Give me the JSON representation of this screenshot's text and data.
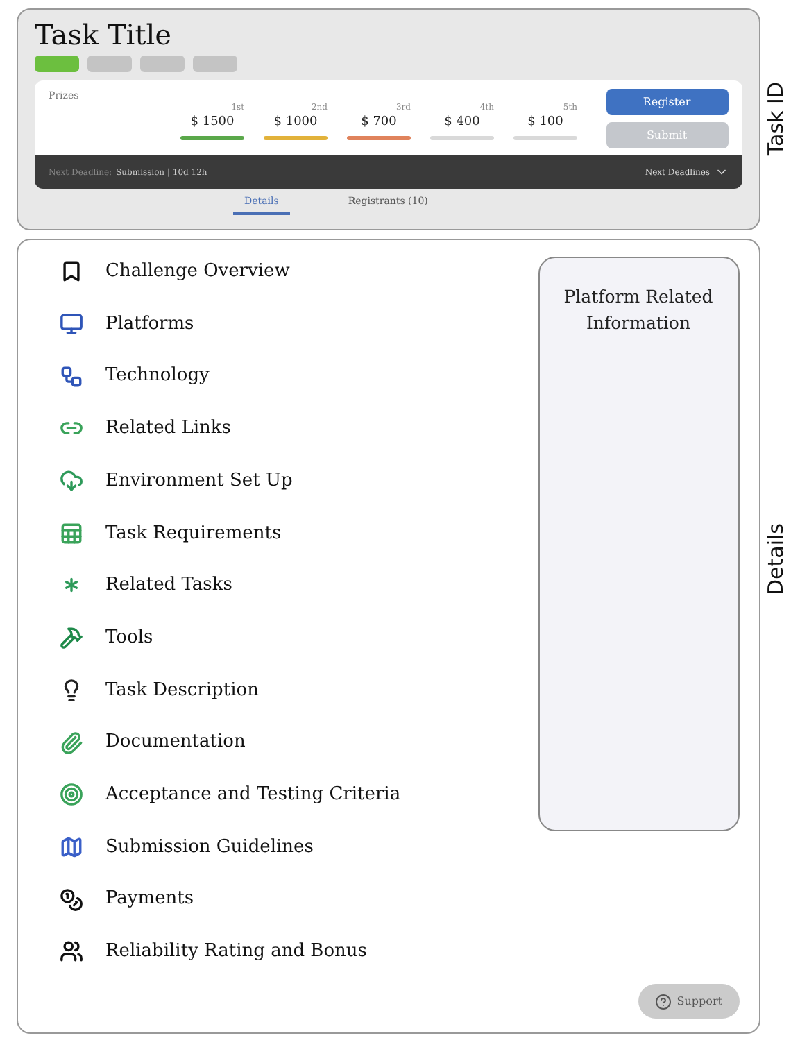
{
  "header": {
    "title": "Task Title",
    "chips": [
      {
        "color": "#6cbf3f"
      },
      {
        "color": "#c4c4c4"
      },
      {
        "color": "#c4c4c4"
      },
      {
        "color": "#c4c4c4"
      }
    ],
    "prizes": {
      "label": "Prizes",
      "items": [
        {
          "place": "1st",
          "amount": "$ 1500",
          "color": "#5aa84a"
        },
        {
          "place": "2nd",
          "amount": "$ 1000",
          "color": "#e2b23a"
        },
        {
          "place": "3rd",
          "amount": "$ 700",
          "color": "#e0835c"
        },
        {
          "place": "4th",
          "amount": "$ 400",
          "color": "#d9d9d9"
        },
        {
          "place": "5th",
          "amount": "$ 100",
          "color": "#d9d9d9"
        }
      ]
    },
    "buttons": [
      {
        "label": "Register",
        "disabled": false
      },
      {
        "label": "Submit",
        "disabled": true
      }
    ],
    "deadline": {
      "label": "Next Deadline:",
      "value": "Submission | 10d 12h",
      "toggle": "Next Deadlines"
    },
    "tabs": [
      {
        "label": "Details",
        "selected": true
      },
      {
        "label": "Registrants (10)",
        "selected": false
      }
    ],
    "side_label": "Task ID"
  },
  "details": {
    "items": [
      {
        "label": "Challenge Overview",
        "color": "#111111"
      },
      {
        "label": "Platforms",
        "color": "#2f55b8"
      },
      {
        "label": "Technology",
        "color": "#2f55b8"
      },
      {
        "label": "Related Links",
        "color": "#3aa35a"
      },
      {
        "label": "Environment Set Up",
        "color": "#2e9a5a"
      },
      {
        "label": "Task Requirements",
        "color": "#3aa35a"
      },
      {
        "label": "Related Tasks",
        "color": "#2e9a5a"
      },
      {
        "label": "Tools",
        "color": "#1f8a4a"
      },
      {
        "label": "Task Description",
        "color": "#222222"
      },
      {
        "label": "Documentation",
        "color": "#3aa35a"
      },
      {
        "label": "Acceptance and Testing Criteria",
        "color": "#3aa35a"
      },
      {
        "label": "Submission Guidelines",
        "color": "#3a5fc8"
      },
      {
        "label": "Payments",
        "color": "#111111"
      },
      {
        "label": "Reliability Rating and Bonus",
        "color": "#111111"
      }
    ],
    "info_panel": "Platform Related Information",
    "support": "Support",
    "side_label": "Details"
  }
}
